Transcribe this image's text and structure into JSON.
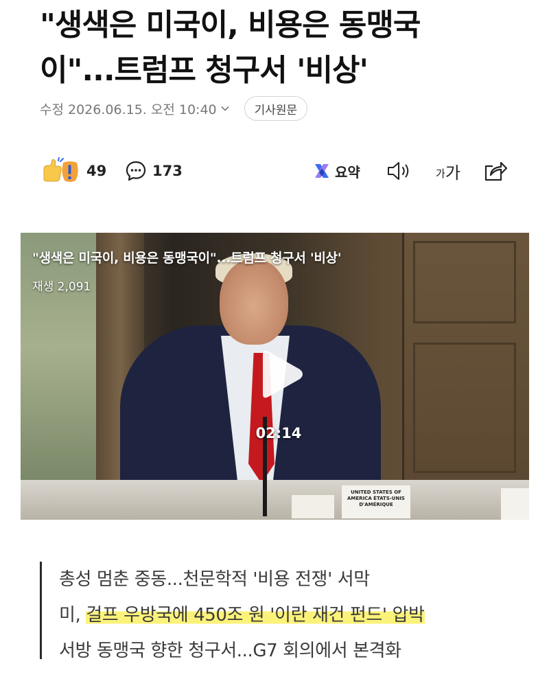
{
  "article": {
    "title_line1": "\"생색은 미국이, 비용은 동맹국",
    "title_line2": "이\"...트럼프 청구서 '비상'",
    "modified": "수정 2026.06.15. 오전 10:40",
    "original_button": "기사원문"
  },
  "actions": {
    "reaction_count": "49",
    "comment_count": "173",
    "summary_label": "요약",
    "font_size_label": "가가",
    "icons": [
      "reaction-icon",
      "comment-icon",
      "summary-icon",
      "listen-icon",
      "font-size-icon",
      "share-icon"
    ]
  },
  "video": {
    "title": "\"생색은 미국이, 비용은 동맹국이\"...트럼프 청구서 '비상'",
    "views": "재생 2,091",
    "duration": "02:14",
    "nameplate": "UNITED STATES OF AMERICA ÉTATS-UNIS D'AMÉRIQUE"
  },
  "summary": {
    "line1": "총성 멈춘 중동...천문학적 '비용 전쟁' 서막",
    "line2_prefix": "미,",
    "line2_highlight": "걸프 우방국에 450조 원 '이란 재건 펀드' 압박",
    "line3": "서방 동맹국 향한 청구서...G7 회의에서 본격화"
  },
  "colors": {
    "highlight": "#fbf27a",
    "summary_bar": "#2a2a2a",
    "summary_icon_blue": "#3b6cf6"
  }
}
